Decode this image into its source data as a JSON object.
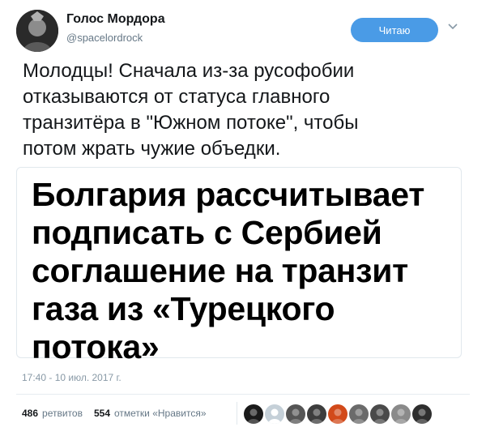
{
  "author": {
    "display_name": "Голос Мордора",
    "handle": "@spacelordrock"
  },
  "follow_button": {
    "label": "Читаю"
  },
  "tweet": {
    "text_lines": [
      "Молодцы! Сначала из-за русофобии",
      "отказываются от статуса главного",
      "транзитёра в \"Южном потоке\", чтобы",
      "потом жрать чужие объедки."
    ],
    "image_headline_lines": [
      "Болгария рассчитывает",
      "подписать с Сербией",
      "соглашение на транзит",
      "газа из «Турецкого",
      "потока»"
    ],
    "timestamp": "17:40 - 10 июл. 2017 г."
  },
  "stats": {
    "retweets_count": "486",
    "retweets_label": "ретвитов",
    "likes_count": "554",
    "likes_label": "отметки «Нравится»"
  },
  "likers": [
    {
      "icon": "avatar-dark",
      "color": "#1a1a1a"
    },
    {
      "icon": "avatar-default-egg",
      "color": "#c5d0d8"
    },
    {
      "icon": "avatar-photo",
      "color": "#555555"
    },
    {
      "icon": "avatar-photo",
      "color": "#3d3d3d"
    },
    {
      "icon": "avatar-colorful",
      "color": "#d24a1a"
    },
    {
      "icon": "avatar-photo",
      "color": "#6b6b6b"
    },
    {
      "icon": "avatar-photo",
      "color": "#4a4a4a"
    },
    {
      "icon": "avatar-photo",
      "color": "#8a8a8a"
    },
    {
      "icon": "avatar-photo",
      "color": "#2e2e2e"
    }
  ]
}
